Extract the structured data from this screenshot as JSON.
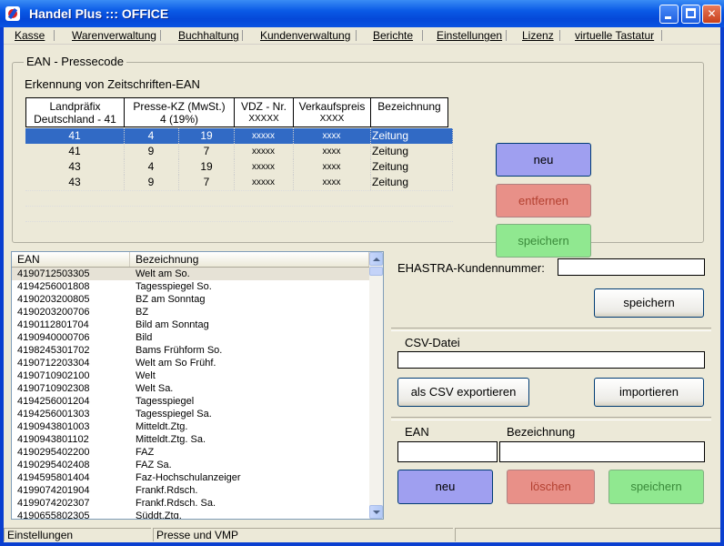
{
  "window": {
    "title": "Handel Plus ::: OFFICE"
  },
  "menu": [
    "Kasse",
    "Warenverwaltung",
    "Buchhaltung",
    "Kundenverwaltung",
    "Berichte",
    "Einstellungen",
    "Lizenz",
    "virtuelle Tastatur"
  ],
  "pressecode": {
    "group_title": "EAN - Pressecode",
    "subtitle": "Erkennung von Zeitschriften-EAN",
    "headers": [
      {
        "l1": "Landpräfix",
        "l2": "Deutschland - 41"
      },
      {
        "l1": "Presse-KZ (MwSt.)",
        "l2": "4 (19%)"
      },
      {
        "l1": "VDZ - Nr.",
        "l2": "XXXXX"
      },
      {
        "l1": "Verkaufspreis",
        "l2": "XXXX"
      },
      {
        "l1": "Bezeichnung",
        "l2": ""
      }
    ],
    "rows": [
      {
        "land": "41",
        "kz": "4",
        "mwst": "19",
        "vdz": "xxxxx",
        "preis": "xxxx",
        "bez": "Zeitung"
      },
      {
        "land": "41",
        "kz": "9",
        "mwst": "7",
        "vdz": "xxxxx",
        "preis": "xxxx",
        "bez": "Zeitung"
      },
      {
        "land": "43",
        "kz": "4",
        "mwst": "19",
        "vdz": "xxxxx",
        "preis": "xxxx",
        "bez": "Zeitung"
      },
      {
        "land": "43",
        "kz": "9",
        "mwst": "7",
        "vdz": "xxxxx",
        "preis": "xxxx",
        "bez": "Zeitung"
      }
    ],
    "buttons": {
      "new": "neu",
      "remove": "entfernen",
      "save": "speichern"
    }
  },
  "ean_list": {
    "col_ean": "EAN",
    "col_bez": "Bezeichnung",
    "items": [
      {
        "ean": "4190712503305",
        "bez": "Welt am So."
      },
      {
        "ean": "4194256001808",
        "bez": "Tagesspiegel So."
      },
      {
        "ean": "4190203200805",
        "bez": "BZ am Sonntag"
      },
      {
        "ean": "4190203200706",
        "bez": "BZ"
      },
      {
        "ean": "4190112801704",
        "bez": "Bild am Sonntag"
      },
      {
        "ean": "4190940000706",
        "bez": "Bild"
      },
      {
        "ean": "4198245301702",
        "bez": "Bams Frühform So."
      },
      {
        "ean": "4190712203304",
        "bez": "Welt am So Frühf."
      },
      {
        "ean": "4190710902100",
        "bez": "Welt"
      },
      {
        "ean": "4190710902308",
        "bez": "Welt Sa."
      },
      {
        "ean": "4194256001204",
        "bez": "Tagesspiegel"
      },
      {
        "ean": "4194256001303",
        "bez": "Tagesspiegel Sa."
      },
      {
        "ean": "4190943801003",
        "bez": "Mitteldt.Ztg."
      },
      {
        "ean": "4190943801102",
        "bez": "Mitteldt.Ztg. Sa."
      },
      {
        "ean": "4190295402200",
        "bez": "FAZ"
      },
      {
        "ean": "4190295402408",
        "bez": "FAZ Sa."
      },
      {
        "ean": "4194595801404",
        "bez": "Faz-Hochschulanzeiger"
      },
      {
        "ean": "4199074201904",
        "bez": "Frankf.Rdsch."
      },
      {
        "ean": "4199074202307",
        "bez": "Frankf.Rdsch. Sa."
      },
      {
        "ean": "4190655802305",
        "bez": "Süddt.Ztg."
      }
    ]
  },
  "ehastra": {
    "label": "EHASTRA-Kundennummer:",
    "value": "",
    "save": "speichern"
  },
  "csv": {
    "label": "CSV-Datei",
    "value": "",
    "export": "als CSV exportieren",
    "import": "importieren"
  },
  "entry": {
    "ean_label": "EAN",
    "bez_label": "Bezeichnung",
    "ean_value": "",
    "bez_value": "",
    "new": "neu",
    "delete": "löschen",
    "save": "speichern"
  },
  "status": [
    "Einstellungen",
    "Presse und VMP",
    ""
  ],
  "colors": {
    "titlebar": "#0a5ae6",
    "selection": "#316ac5",
    "btn_blue": "#9f9ff0",
    "btn_red": "#e89088",
    "btn_green": "#90e890"
  }
}
